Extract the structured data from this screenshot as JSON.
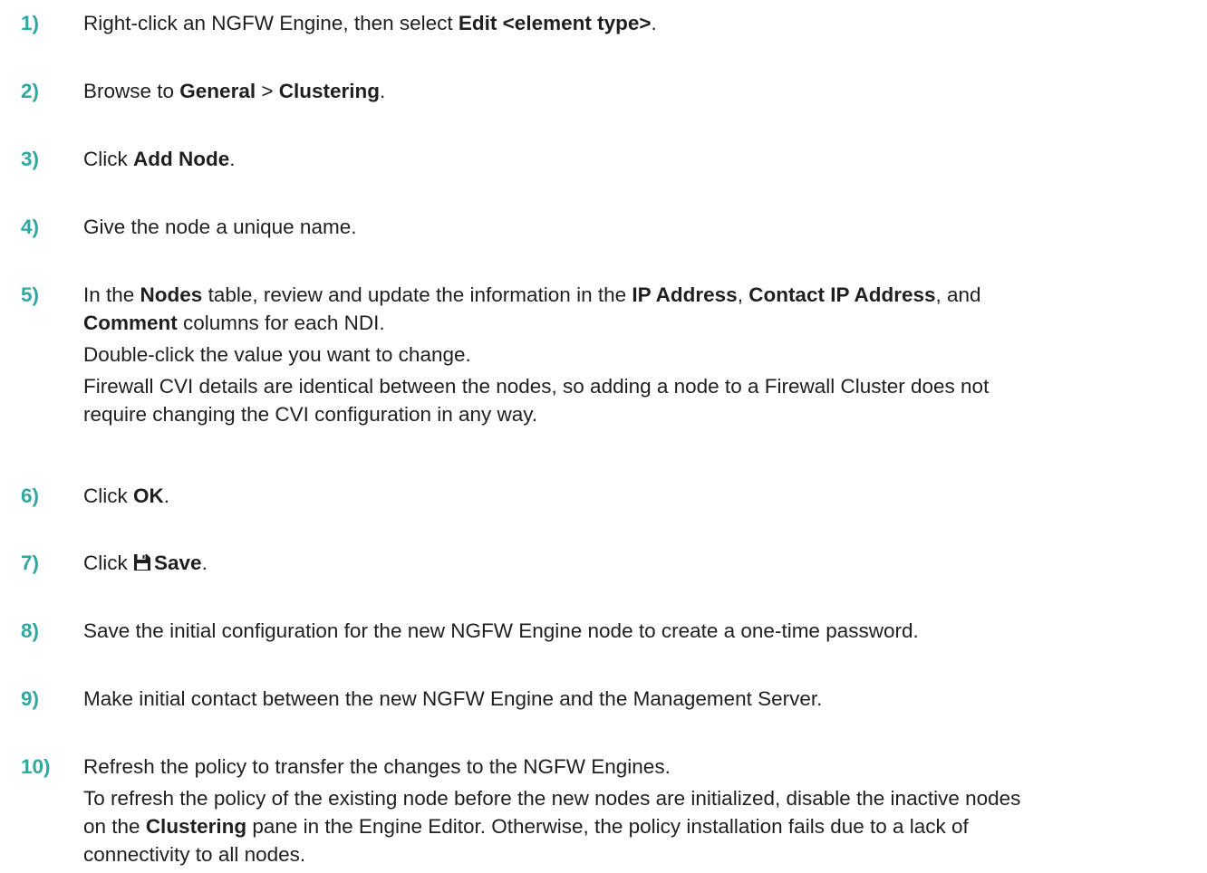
{
  "steps": [
    {
      "number": "1)",
      "parts": {
        "a": "Right-click an NGFW Engine, then select ",
        "b": "Edit <element type>",
        "c": "."
      }
    },
    {
      "number": "2)",
      "parts": {
        "a": "Browse to ",
        "b": "General",
        "c": " > ",
        "d": "Clustering",
        "e": "."
      }
    },
    {
      "number": "3)",
      "parts": {
        "a": "Click ",
        "b": "Add Node",
        "c": "."
      }
    },
    {
      "number": "4)",
      "text": "Give the node a unique name."
    },
    {
      "number": "5)",
      "parts": {
        "a": "In the ",
        "b": "Nodes",
        "c": " table, review and update the information in the ",
        "d": "IP Address",
        "e": ", ",
        "f": "Contact IP Address",
        "g": ", and",
        "h": "Comment",
        "i": " columns for each NDI."
      },
      "note1": "Double-click the value you want to change.",
      "note2a": "Firewall CVI details are identical between the nodes, so adding a node to a Firewall Cluster does not",
      "note2b": "require changing the CVI configuration in any way."
    },
    {
      "number": "6)",
      "parts": {
        "a": "Click ",
        "b": "OK",
        "c": "."
      }
    },
    {
      "number": "7)",
      "icon": "save-icon",
      "parts": {
        "a": "Click ",
        "b": "Save",
        "c": "."
      }
    },
    {
      "number": "8)",
      "text": "Save the initial configuration for the new NGFW Engine node to create a one-time password."
    },
    {
      "number": "9)",
      "text": "Make initial contact between the new NGFW Engine and the Management Server."
    },
    {
      "number": "10)",
      "text": "Refresh the policy to transfer the changes to the NGFW Engines.",
      "parts": {
        "a": "To refresh the policy of the existing node before the new nodes are initialized, disable the inactive nodes",
        "b": "on the ",
        "c": "Clustering",
        "d": " pane in the Engine Editor. Otherwise, the policy installation fails due to a lack of",
        "e": "connectivity to all nodes."
      }
    }
  ],
  "colors": {
    "step_number": "#2fa8a0",
    "text": "#1f1f1f",
    "background": "#ffffff"
  }
}
